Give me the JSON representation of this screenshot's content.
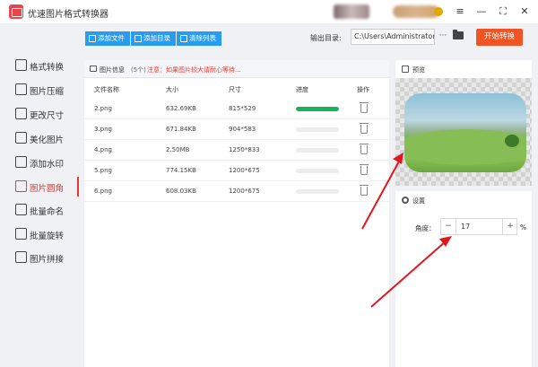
{
  "window": {
    "title": "优速图片格式转换器",
    "controls": [
      "≡",
      "—",
      "⛶",
      "✕"
    ]
  },
  "sidebar": {
    "items": [
      {
        "label": "格式转换",
        "icon": "convert-icon",
        "active": false
      },
      {
        "label": "图片压缩",
        "icon": "compress-icon",
        "active": false
      },
      {
        "label": "更改尺寸",
        "icon": "resize-icon",
        "active": false
      },
      {
        "label": "美化图片",
        "icon": "beautify-icon",
        "active": false
      },
      {
        "label": "添加水印",
        "icon": "watermark-icon",
        "active": false
      },
      {
        "label": "图片圆角",
        "icon": "round-corner-icon",
        "active": true
      },
      {
        "label": "批量命名",
        "icon": "rename-icon",
        "active": false
      },
      {
        "label": "批量旋转",
        "icon": "rotate-icon",
        "active": false
      },
      {
        "label": "图片拼接",
        "icon": "stitch-icon",
        "active": false
      }
    ]
  },
  "toolbar": {
    "add_file": "添加文件",
    "add_folder": "添加目录",
    "clear_list": "清除列表",
    "output_label": "输出目录:",
    "output_path": "C:\\Users\\Administrator\\",
    "more": "···",
    "start": "开始转换"
  },
  "file_panel": {
    "title": "图片信息",
    "count": "(5个)",
    "note": "注意：如果图片较大请耐心等待...",
    "columns": [
      "文件名称",
      "大小",
      "尺寸",
      "进度",
      "操作"
    ],
    "rows": [
      {
        "name": "2.png",
        "size": "632.69KB",
        "dims": "815*529",
        "progress": 1.0
      },
      {
        "name": "3.png",
        "size": "671.84KB",
        "dims": "904*583",
        "progress": 0
      },
      {
        "name": "4.png",
        "size": "2.50MB",
        "dims": "1250*833",
        "progress": 0
      },
      {
        "name": "5.png",
        "size": "774.15KB",
        "dims": "1200*675",
        "progress": 0
      },
      {
        "name": "6.png",
        "size": "608.03KB",
        "dims": "1200*675",
        "progress": 0
      }
    ]
  },
  "preview": {
    "title": "预览"
  },
  "settings": {
    "title": "设置",
    "angle_label": "角度：",
    "angle_value": "17",
    "decrement": "−",
    "increment": "+",
    "unit": "%"
  },
  "colors": {
    "accent": "#e53935",
    "toolbar_blue": "#2a9cf0",
    "start_orange": "#f05424",
    "progress_green": "#19b35b"
  }
}
